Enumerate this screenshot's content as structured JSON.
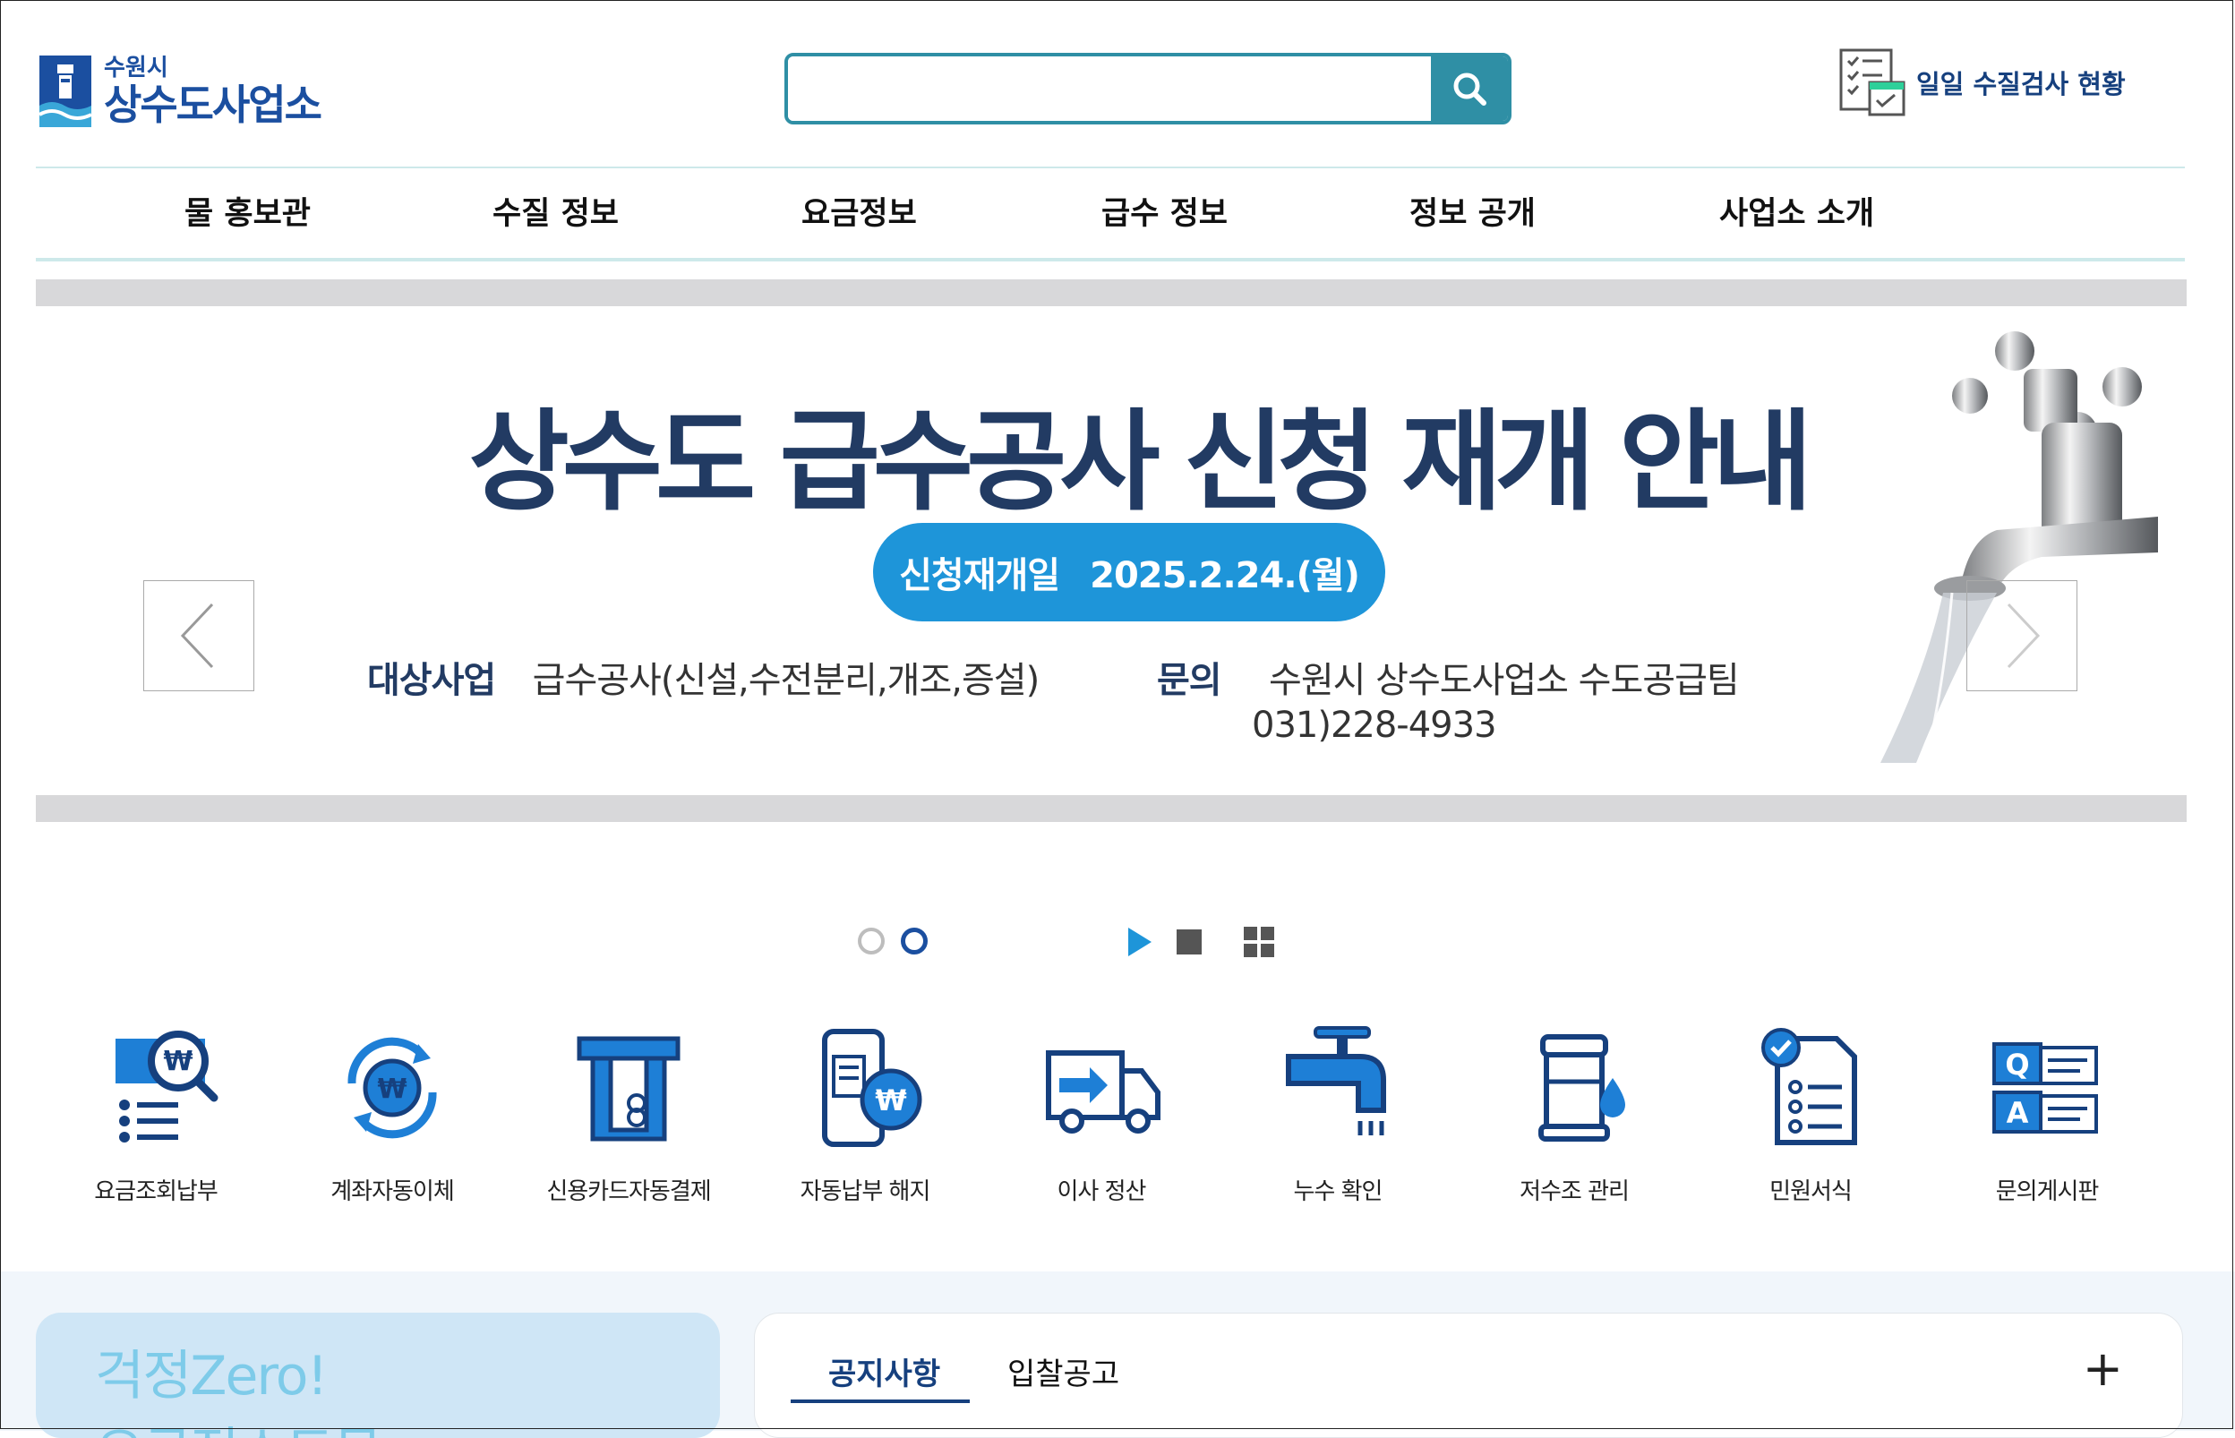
{
  "header": {
    "logo_city": "수원시",
    "logo_name": "상수도사업소",
    "search_value": "",
    "water_quality_link": "일일 수질검사 현황"
  },
  "nav": [
    "물 홍보관",
    "수질 정보",
    "요금정보",
    "급수 정보",
    "정보 공개",
    "사업소 소개"
  ],
  "banner": {
    "title": "상수도 급수공사 신청 재개 안내",
    "pill_label": "신청재개일",
    "pill_date": "2025.2.24.(월)",
    "target_label": "대상사업",
    "target_value": "급수공사(신설,수전분리,개조,증설)",
    "inquiry_label": "문의",
    "inquiry_value": "수원시 상수도사업소 수도공급팀",
    "inquiry_phone": "031)228-4933"
  },
  "slider": {
    "total_slides": 2,
    "current_slide": 2
  },
  "quick_menu": [
    "요금조회납부",
    "계좌자동이체",
    "신용카드자동결제",
    "자동납부 해지",
    "이사 정산",
    "누수 확인",
    "저수조 관리",
    "민원서식",
    "문의게시판"
  ],
  "promo": {
    "line1": "걱정Zero!",
    "line2": "요금정소도무"
  },
  "board": {
    "tabs": [
      "공지사항",
      "입찰공고"
    ],
    "active_tab": 0,
    "more": "+"
  },
  "colors": {
    "brand": "#1b4fa0",
    "accent": "#2f8fa5",
    "navy": "#223b63",
    "pill": "#1e95d9"
  }
}
